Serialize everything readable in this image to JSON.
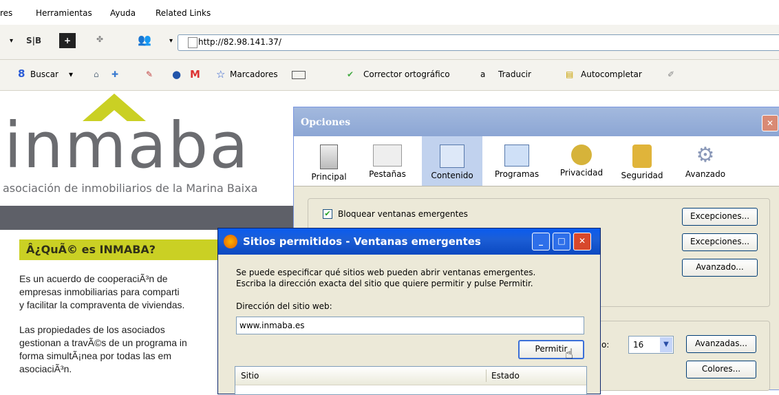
{
  "menu": {
    "items": [
      "res",
      "Herramientas",
      "Ayuda",
      "Related Links"
    ]
  },
  "toolbar": {
    "sb_label": "S|B",
    "url": "http://82.98.141.37/"
  },
  "gbar": {
    "search": "Buscar",
    "bookmarks": "Marcadores",
    "spellcheck": "Corrector ortográfico",
    "translate": "Traducir",
    "autofill": "Autocompletar"
  },
  "page": {
    "logo": "inmaba",
    "subtitle": "asociación de inmobiliarios de la Marina Baixa",
    "question_heading": "Â¿QuÃ© es INMABA?",
    "para1": [
      "Es un acuerdo de cooperaciÃ³n de",
      "empresas inmobiliarias para comparti",
      "y facilitar la compraventa de viviendas."
    ],
    "para2": [
      "Las propiedades de los asociados",
      "gestionan a travÃ©s de un programa in",
      "forma simultÃ¡nea por todas las em",
      "asociaciÃ³n."
    ]
  },
  "options_dialog": {
    "title": "Opciones",
    "tabs": [
      "Principal",
      "Pestañas",
      "Contenido",
      "Programas",
      "Privacidad",
      "Seguridad",
      "Avanzado"
    ],
    "selected_tab": "Contenido",
    "block_popups_label": "Bloquear ventanas emergentes",
    "block_popups_checked": true,
    "buttons": {
      "exceptions1": "Excepciones...",
      "exceptions2": "Excepciones...",
      "advanced": "Avanzado...",
      "advanced_fonts": "Avanzadas...",
      "colors": "Colores..."
    },
    "font_size_label": "año:",
    "font_size_value": "16"
  },
  "allowed_sites_dialog": {
    "title": "Sitios permitidos - Ventanas emergentes",
    "description_line1": "Se puede especificar qué sitios web pueden abrir ventanas emergentes.",
    "description_line2": "Escriba la dirección exacta del sitio que quiere permitir y pulse Permitir.",
    "address_label": "Dirección del sitio web:",
    "address_value": "www.inmaba.es",
    "allow_button": "Permitir",
    "col_site": "Sitio",
    "col_status": "Estado"
  },
  "colors": {
    "accent_lime": "#cad024",
    "xp_blue": "#0b49c1",
    "logo_gray": "#6b6c70"
  }
}
